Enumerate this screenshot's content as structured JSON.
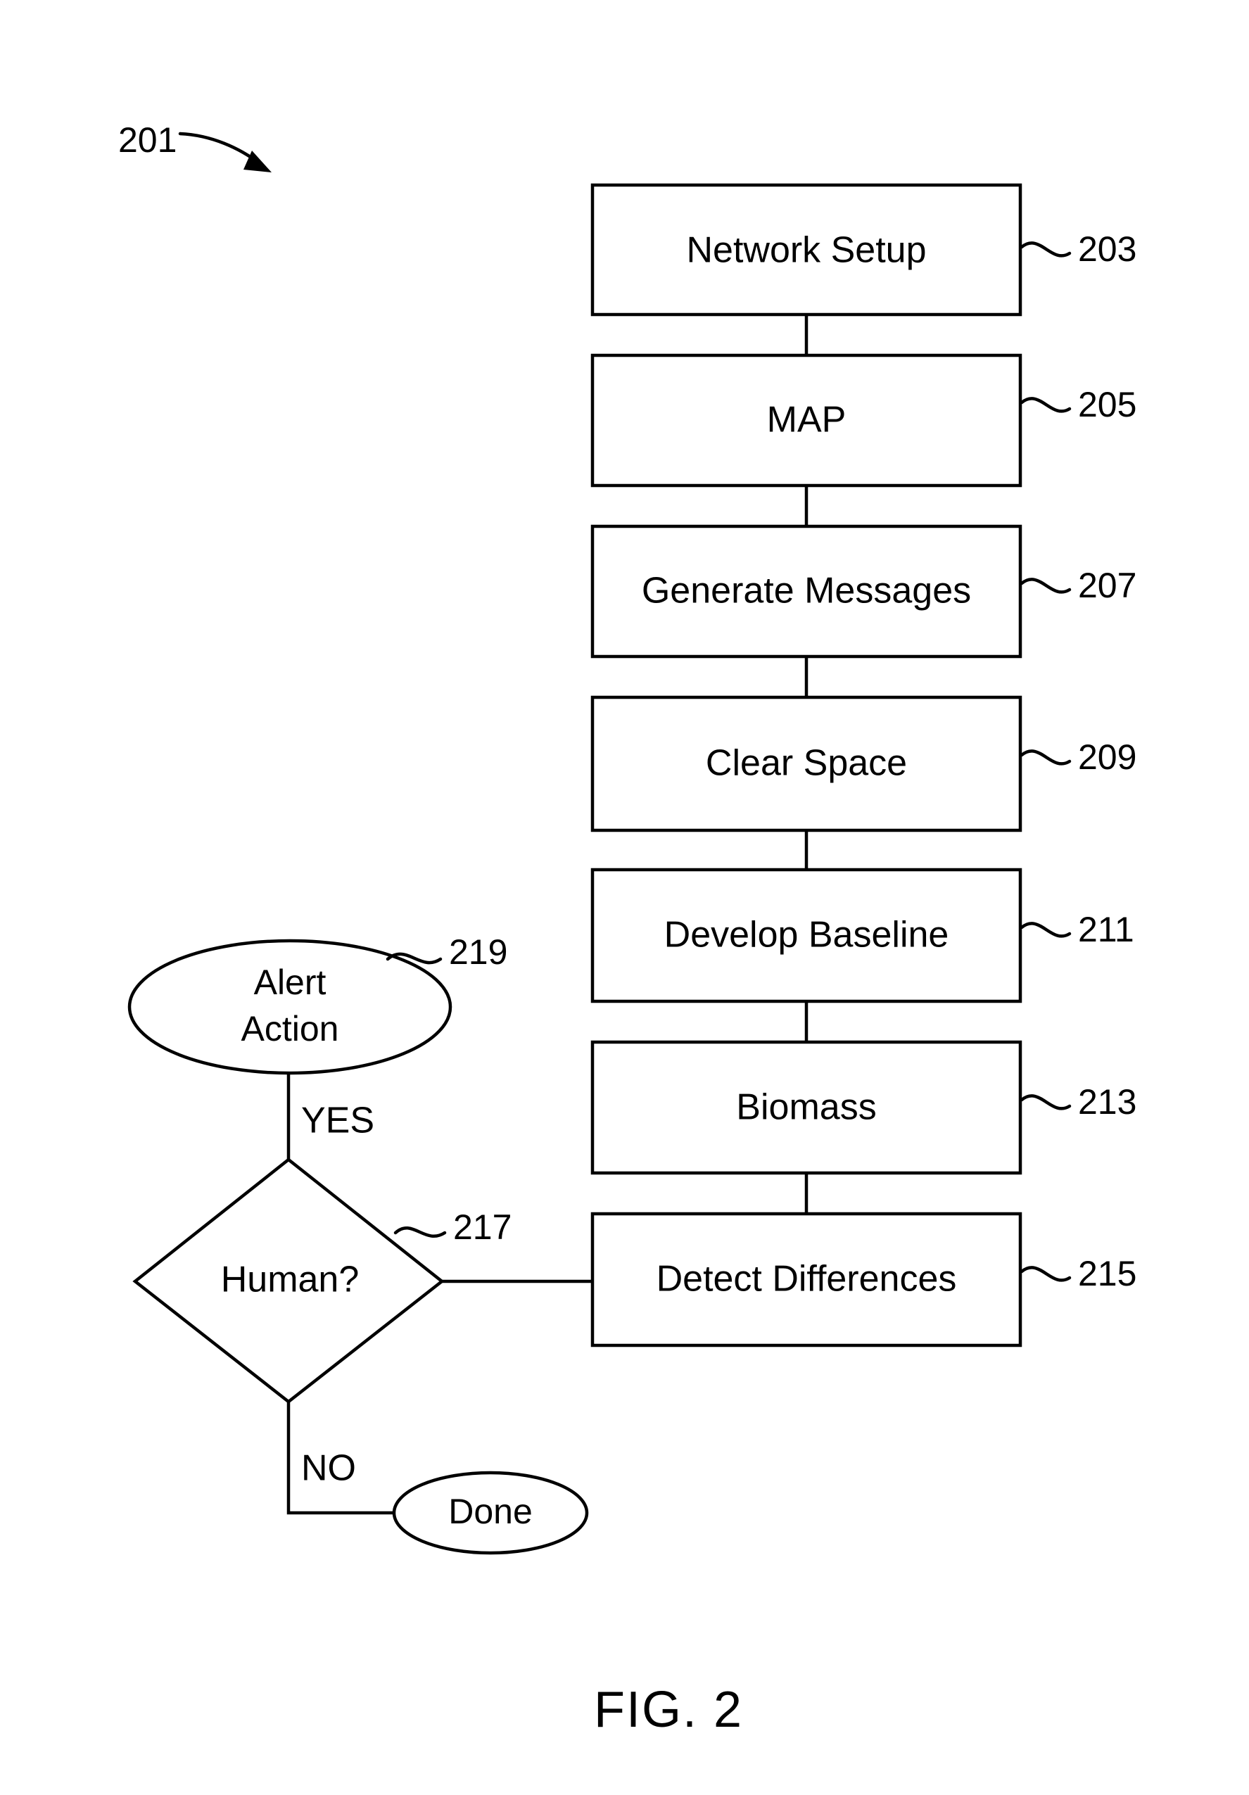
{
  "figure": {
    "caption": "FIG. 2",
    "diagram_ref": "201"
  },
  "process_boxes": [
    {
      "label": "Network Setup",
      "ref": "203"
    },
    {
      "label": "MAP",
      "ref": "205"
    },
    {
      "label": "Generate Messages",
      "ref": "207"
    },
    {
      "label": "Clear Space",
      "ref": "209"
    },
    {
      "label": "Develop Baseline",
      "ref": "211"
    },
    {
      "label": "Biomass",
      "ref": "213"
    },
    {
      "label": "Detect Differences",
      "ref": "215"
    }
  ],
  "decision": {
    "label": "Human?",
    "ref": "217",
    "yes_label": "YES",
    "no_label": "NO"
  },
  "terminals": [
    {
      "label_line1": "Alert",
      "label_line2": "Action",
      "ref": "219"
    },
    {
      "label_line1": "Done",
      "label_line2": "",
      "ref": ""
    }
  ],
  "colors": {
    "stroke": "#000000",
    "fill": "#ffffff",
    "background": "#ffffff"
  }
}
